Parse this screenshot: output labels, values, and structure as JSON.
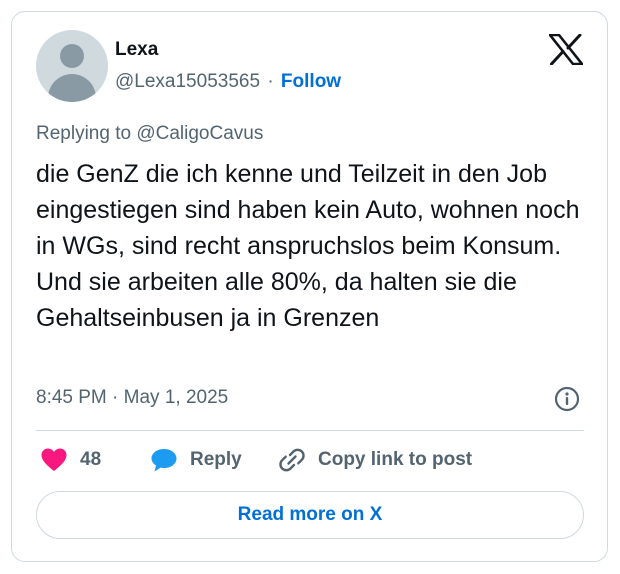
{
  "author": {
    "display_name": "Lexa",
    "handle": "@Lexa15053565",
    "separator": "·",
    "follow_label": "Follow",
    "avatar_icon": "default-avatar-icon"
  },
  "brand": {
    "logo_icon": "x-logo-icon"
  },
  "reply_context": {
    "prefix": "Replying to",
    "handle": "@CaligoCavus"
  },
  "tweet": {
    "text": "die GenZ die ich kenne und Teilzeit in den Job eingestiegen sind haben kein Auto, wohnen noch in WGs, sind recht anspruchslos beim Konsum. Und sie arbeiten alle 80%, da halten sie die Gehaltseinbusen ja in Grenzen",
    "time": "8:45 PM",
    "date_separator": "·",
    "date": "May 1, 2025",
    "info_icon": "info-icon"
  },
  "actions": {
    "like_count": "48",
    "like_icon": "heart-icon",
    "reply_label": "Reply",
    "reply_icon": "speech-bubble-icon",
    "copy_label": "Copy link to post",
    "copy_icon": "link-icon"
  },
  "footer": {
    "read_more_label": "Read more on X"
  },
  "colors": {
    "accent": "#006fd6",
    "like": "#f91880",
    "reply": "#1d9bf0",
    "muted": "#536471",
    "border": "#cfd9de",
    "text": "#0f1419"
  }
}
